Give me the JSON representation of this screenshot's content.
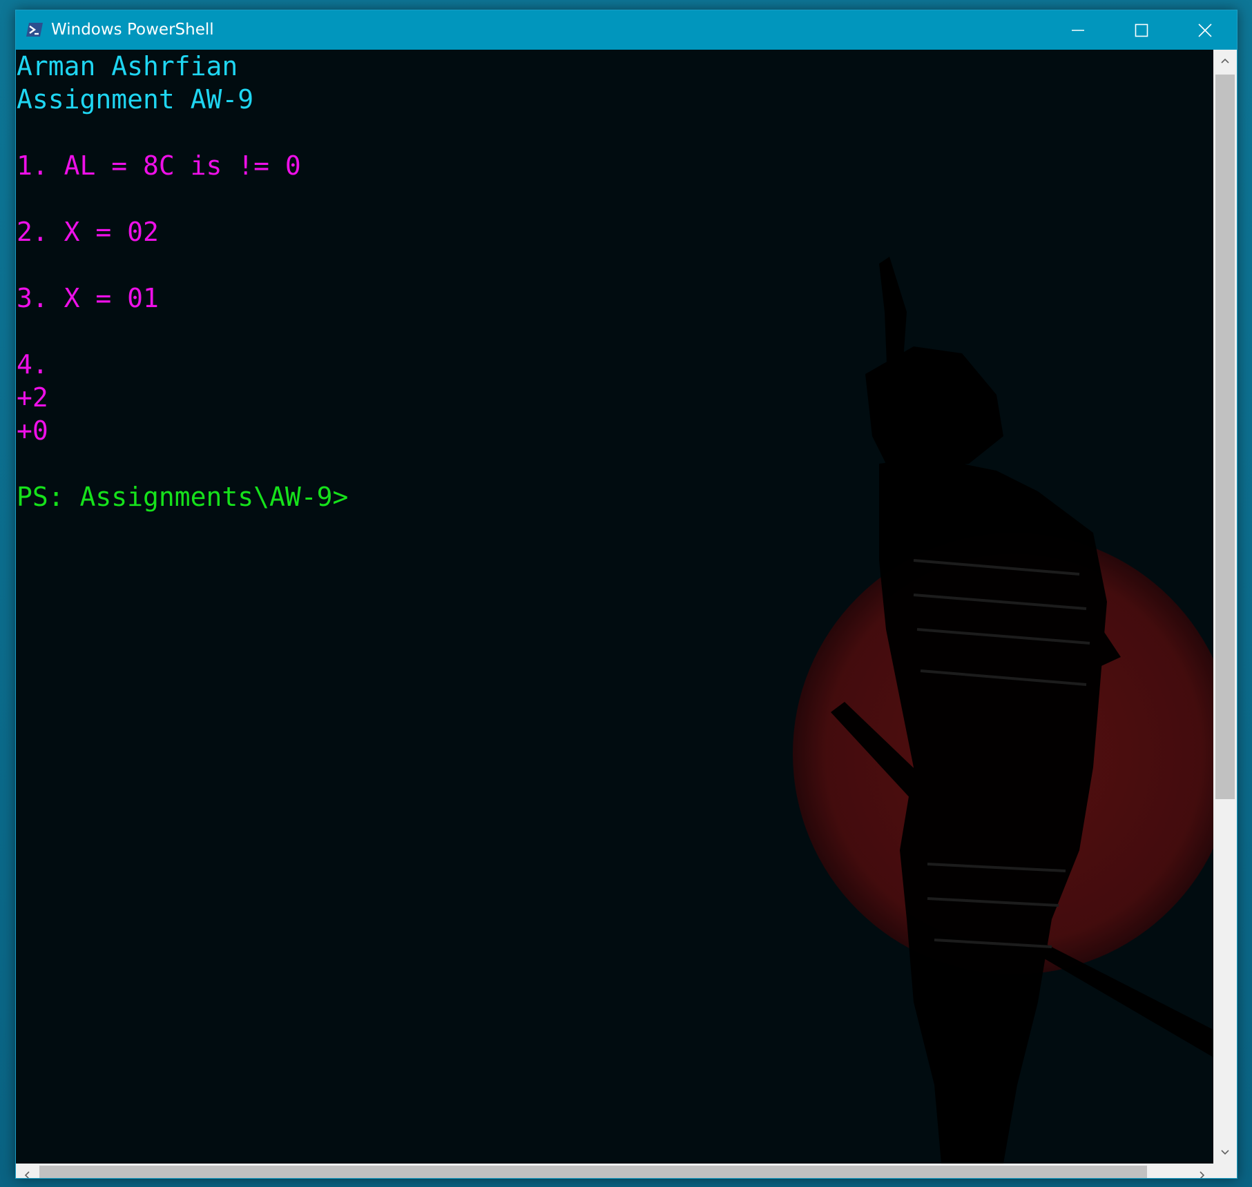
{
  "window": {
    "title": "Windows PowerShell",
    "app_icon": "powershell-icon"
  },
  "caption_buttons": {
    "minimize_icon": "minimize-icon",
    "maximize_icon": "maximize-icon",
    "close_icon": "close-icon"
  },
  "console": {
    "lines": [
      {
        "text": "Arman Ashrfian",
        "color": "#1fd6f2"
      },
      {
        "text": "Assignment AW-9",
        "color": "#1fd6f2"
      },
      {
        "text": "",
        "color": "#1fd6f2"
      },
      {
        "text": "1. AL = 8C is != 0",
        "color": "#ee10e8"
      },
      {
        "text": "",
        "color": "#ee10e8"
      },
      {
        "text": "2. X = 02",
        "color": "#ee10e8"
      },
      {
        "text": "",
        "color": "#ee10e8"
      },
      {
        "text": "3. X = 01",
        "color": "#ee10e8"
      },
      {
        "text": "",
        "color": "#ee10e8"
      },
      {
        "text": "4.",
        "color": "#ee10e8"
      },
      {
        "text": "+2",
        "color": "#ee10e8"
      },
      {
        "text": "+0",
        "color": "#ee10e8"
      },
      {
        "text": "",
        "color": "#ee10e8"
      },
      {
        "text": "PS: Assignments\\AW-9>",
        "color": "#16e21b"
      }
    ]
  },
  "scrollbars": {
    "up_icon": "chevron-up-icon",
    "down_icon": "chevron-down-icon",
    "left_icon": "chevron-left-icon",
    "right_icon": "chevron-right-icon"
  },
  "colors": {
    "titlebar": "#0196bd",
    "console_bg": "#010c10",
    "cyan": "#1fd6f2",
    "magenta": "#ee10e8",
    "green": "#16e21b",
    "sun_red": "#7a1414"
  }
}
